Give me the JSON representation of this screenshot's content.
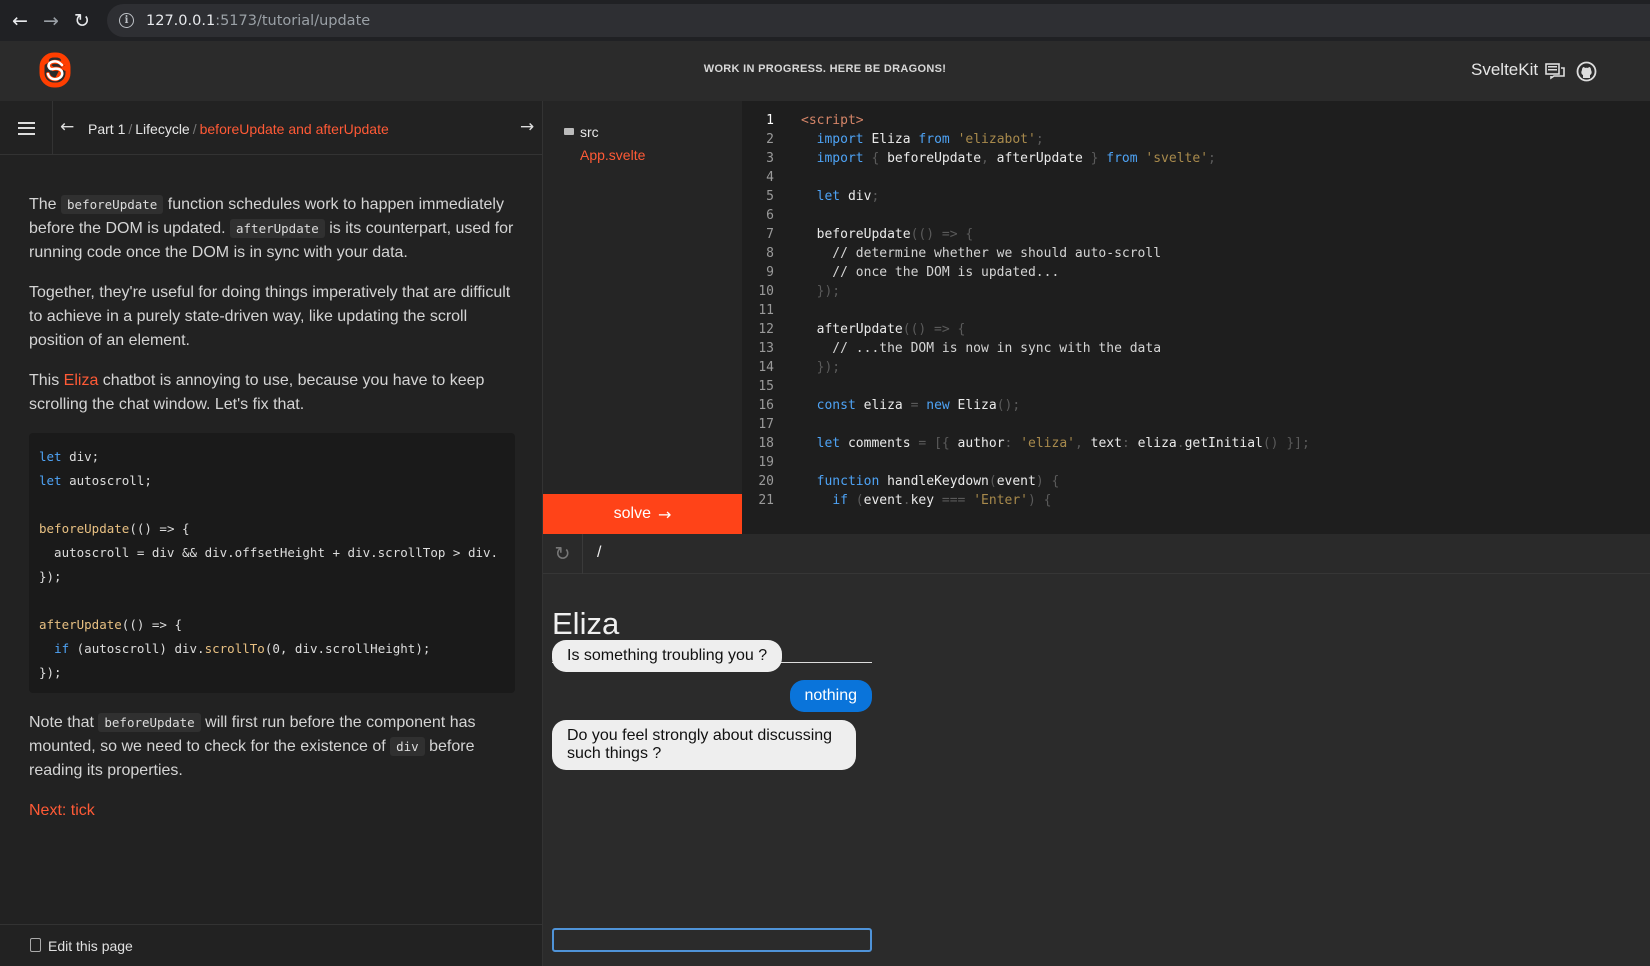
{
  "browser": {
    "url_host": "127.0.0.1",
    "url_path": ":5173/tutorial/update"
  },
  "header": {
    "banner": "WORK IN PROGRESS. HERE BE DRAGONS!",
    "brand": "SvelteKit"
  },
  "breadcrumb": {
    "part": "Part 1",
    "section": "Lifecycle",
    "current": "beforeUpdate and afterUpdate"
  },
  "tutorial": {
    "p1_a": "The ",
    "p1_code1": "beforeUpdate",
    "p1_b": " function schedules work to happen immediately before the DOM is updated. ",
    "p1_code2": "afterUpdate",
    "p1_c": " is its counterpart, used for running code once the DOM is in sync with your data.",
    "p2": "Together, they're useful for doing things imperatively that are difficult to achieve in a purely state-driven way, like updating the scroll position of an element.",
    "p3_a": "This ",
    "p3_link": "Eliza",
    "p3_b": " chatbot is annoying to use, because you have to keep scrolling the chat window. Let's fix that.",
    "code": {
      "l1_kw": "let",
      "l1_rest": " div;",
      "l2_kw": "let",
      "l2_rest": " autoscroll;",
      "l4_fn": "beforeUpdate",
      "l4_rest": "(() => {",
      "l5": "  autoscroll = div && div.offsetHeight + div.scrollTop > div.",
      "l6": "});",
      "l8_fn": "afterUpdate",
      "l8_rest": "(() => {",
      "l9_ind": "  ",
      "l9_kw": "if",
      "l9_mid": " (autoscroll) div.",
      "l9_fn": "scrollTo",
      "l9_rest": "(0, div.scrollHeight);",
      "l10": "});"
    },
    "p4_a": "Note that ",
    "p4_code1": "beforeUpdate",
    "p4_b": " will first run before the component has mounted, so we need to check for the existence of ",
    "p4_code2": "div",
    "p4_c": " before reading its properties.",
    "next": "Next: tick"
  },
  "footer": {
    "edit": "Edit this page"
  },
  "files": {
    "folder": "src",
    "file": "App.svelte"
  },
  "solve": {
    "label": "solve"
  },
  "editor": {
    "active_line": 1,
    "lines": [
      [
        [
          "<script>",
          "tag"
        ]
      ],
      [
        [
          "  ",
          ""
        ],
        [
          "import",
          "kw"
        ],
        [
          " Eliza ",
          ""
        ],
        [
          "from",
          "kw"
        ],
        [
          " ",
          ""
        ],
        [
          "'elizabot'",
          "str"
        ],
        [
          ";",
          "punc"
        ]
      ],
      [
        [
          "  ",
          ""
        ],
        [
          "import",
          "kw"
        ],
        [
          " ",
          ""
        ],
        [
          "{",
          "punc"
        ],
        [
          " beforeUpdate",
          ""
        ],
        [
          ",",
          "punc"
        ],
        [
          " afterUpdate ",
          ""
        ],
        [
          "}",
          "punc"
        ],
        [
          " ",
          ""
        ],
        [
          "from",
          "kw"
        ],
        [
          " ",
          ""
        ],
        [
          "'svelte'",
          "str"
        ],
        [
          ";",
          "punc"
        ]
      ],
      [],
      [
        [
          "  ",
          ""
        ],
        [
          "let",
          "kw"
        ],
        [
          " div",
          ""
        ],
        [
          ";",
          "punc"
        ]
      ],
      [],
      [
        [
          "  beforeUpdate",
          ""
        ],
        [
          "(() => {",
          "punc"
        ]
      ],
      [
        [
          "    // determine whether we should auto-scroll",
          "com"
        ]
      ],
      [
        [
          "    // once the DOM is updated...",
          "com"
        ]
      ],
      [
        [
          "  ",
          ""
        ],
        [
          "});",
          "punc"
        ]
      ],
      [],
      [
        [
          "  afterUpdate",
          ""
        ],
        [
          "(() => {",
          "punc"
        ]
      ],
      [
        [
          "    // ...the DOM is now in sync with the data",
          "com"
        ]
      ],
      [
        [
          "  ",
          ""
        ],
        [
          "});",
          "punc"
        ]
      ],
      [],
      [
        [
          "  ",
          ""
        ],
        [
          "const",
          "kw"
        ],
        [
          " eliza ",
          ""
        ],
        [
          "=",
          "punc"
        ],
        [
          " ",
          ""
        ],
        [
          "new",
          "kw"
        ],
        [
          " Eliza",
          ""
        ],
        [
          "();",
          "punc"
        ]
      ],
      [],
      [
        [
          "  ",
          ""
        ],
        [
          "let",
          "kw"
        ],
        [
          " comments ",
          ""
        ],
        [
          "=",
          "punc"
        ],
        [
          " ",
          ""
        ],
        [
          "[{",
          "punc"
        ],
        [
          " author",
          ""
        ],
        [
          ":",
          "punc"
        ],
        [
          " ",
          ""
        ],
        [
          "'eliza'",
          "str"
        ],
        [
          ",",
          "punc"
        ],
        [
          " text",
          ""
        ],
        [
          ":",
          "punc"
        ],
        [
          " eliza",
          ""
        ],
        [
          ".",
          "punc"
        ],
        [
          "getInitial",
          ""
        ],
        [
          "()",
          "punc"
        ],
        [
          " ",
          ""
        ],
        [
          "}];",
          "punc"
        ]
      ],
      [],
      [
        [
          "  ",
          ""
        ],
        [
          "function",
          "kw"
        ],
        [
          " handleKeydown",
          ""
        ],
        [
          "(",
          "punc"
        ],
        [
          "event",
          ""
        ],
        [
          ")",
          "punc"
        ],
        [
          " ",
          ""
        ],
        [
          "{",
          "punc"
        ]
      ],
      [
        [
          "    ",
          ""
        ],
        [
          "if",
          "kw"
        ],
        [
          " ",
          ""
        ],
        [
          "(",
          "punc"
        ],
        [
          "event",
          ""
        ],
        [
          ".",
          "punc"
        ],
        [
          "key ",
          ""
        ],
        [
          "===",
          "punc"
        ],
        [
          " ",
          ""
        ],
        [
          "'Enter'",
          "str"
        ],
        [
          ")",
          "punc"
        ],
        [
          " ",
          ""
        ],
        [
          "{",
          "punc"
        ]
      ]
    ]
  },
  "preview": {
    "path": "/",
    "title": "Eliza",
    "messages": [
      {
        "author": "eliza",
        "text": "Is something troubling you ?"
      },
      {
        "author": "user",
        "text": "nothing"
      },
      {
        "author": "eliza",
        "text": "Do you feel strongly about discussing such things ?"
      }
    ],
    "input_value": ""
  }
}
